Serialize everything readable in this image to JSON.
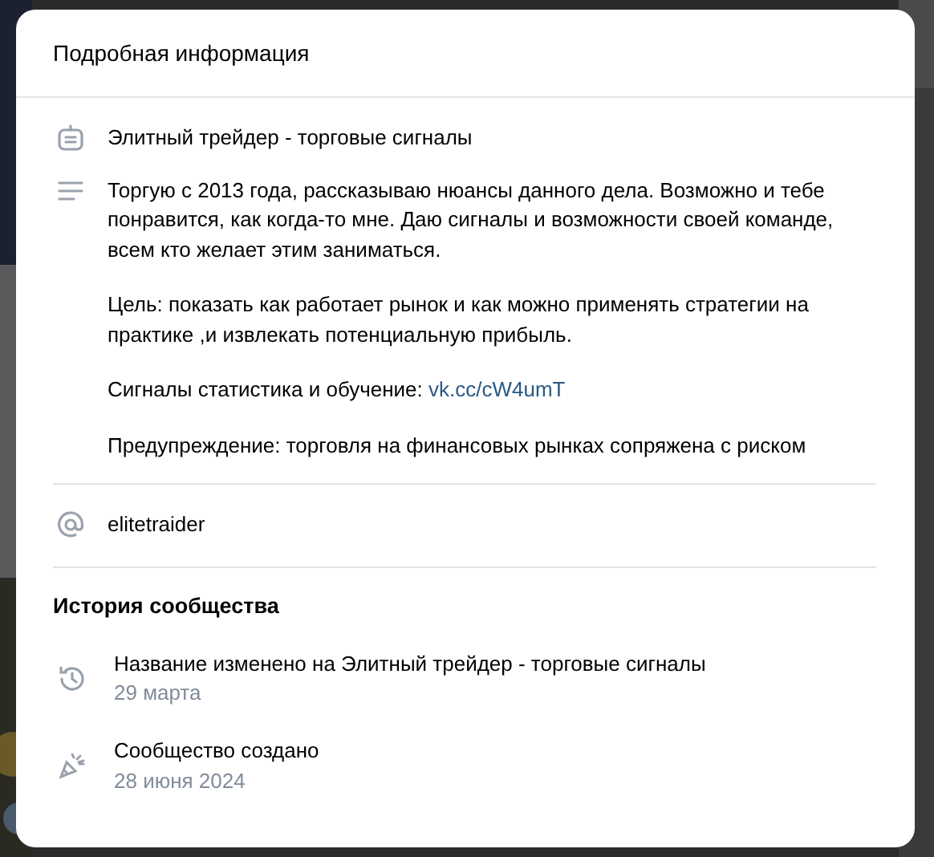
{
  "dialog": {
    "title": "Подробная информация"
  },
  "info": [
    {
      "kind": "name",
      "paragraphs": [
        {
          "text": "Элитный трейдер - торговые сигналы"
        }
      ]
    },
    {
      "kind": "description",
      "paragraphs": [
        {
          "text": "Торгую с 2013 года, рассказываю нюансы данного дела. Возможно и тебе понравится, как когда-то мне. Даю сигналы и возможности своей команде, всем кто желает этим заниматься."
        },
        {
          "text": "Цель: показать как работает рынок и как можно применять стратегии на практике ,и извлекать потенциальную прибыль."
        },
        {
          "text": "Сигналы статистика и обучение: ",
          "link": "vk.cc/cW4umT"
        },
        {
          "text": "Предупреждение: торговля на финансовых рынках сопряжена с риском"
        }
      ]
    }
  ],
  "address": {
    "kind": "at",
    "text": "elitetraider"
  },
  "history": {
    "title": "История сообщества",
    "events": [
      {
        "kind": "renamed",
        "text": "Название изменено на Элитный трейдер - торговые сигналы",
        "date": "29 марта"
      },
      {
        "kind": "created",
        "text": "Сообщество создано",
        "date": "28 июня 2024"
      }
    ]
  }
}
